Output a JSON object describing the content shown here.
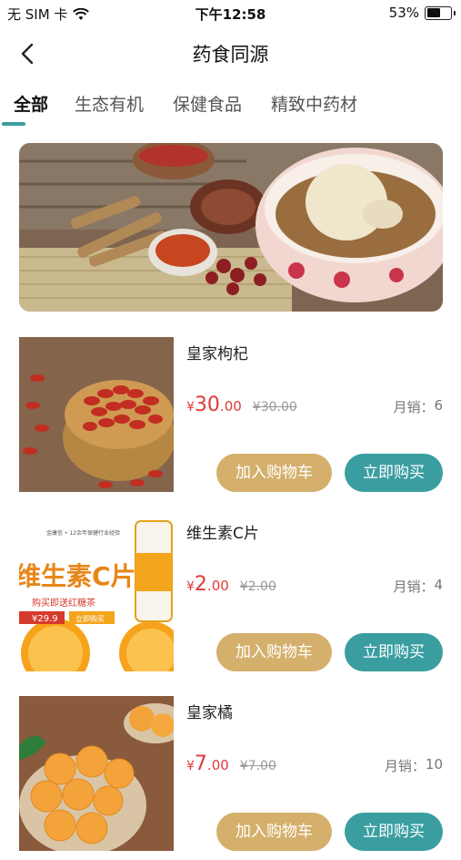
{
  "status_bar": {
    "carrier": "无 SIM 卡",
    "time": "下午12:58",
    "battery_percent": "53%",
    "battery_level": 0.53,
    "icons": [
      "wifi-icon",
      "battery-icon"
    ]
  },
  "nav": {
    "title": "药食同源",
    "back_icon": "chevron-left-icon"
  },
  "tabs": [
    {
      "label": "全部",
      "active": true
    },
    {
      "label": "生态有机",
      "active": false
    },
    {
      "label": "保健食品",
      "active": false
    },
    {
      "label": "精致中药材",
      "active": false
    }
  ],
  "products": [
    {
      "name": "皇家枸杞",
      "currency": "¥",
      "price_int": "30",
      "price_dec": ".00",
      "old_price": "¥30.00",
      "sales_label": "月销：",
      "sales_count": "6",
      "add_cart_label": "加入购物车",
      "buy_label": "立即购买"
    },
    {
      "name": "维生素C片",
      "currency": "¥",
      "price_int": "2",
      "price_dec": ".00",
      "old_price": "¥2.00",
      "sales_label": "月销：",
      "sales_count": "4",
      "add_cart_label": "加入购物车",
      "buy_label": "立即购买",
      "thumb_text": {
        "brand": "金康信 • 12余年保健行业经验",
        "headline": "维生素C片",
        "promo": "购买即送红糖茶",
        "promo_price": "¥29.9",
        "promo_button": "立即购买"
      }
    },
    {
      "name": "皇家橘",
      "currency": "¥",
      "price_int": "7",
      "price_dec": ".00",
      "old_price": "¥7.00",
      "sales_label": "月销：",
      "sales_count": "10",
      "add_cart_label": "加入购物车",
      "buy_label": "立即购买"
    }
  ],
  "colors": {
    "accent_teal": "#3a9ea0",
    "accent_gold": "#d4b06c",
    "price_red": "#e03a3a"
  }
}
